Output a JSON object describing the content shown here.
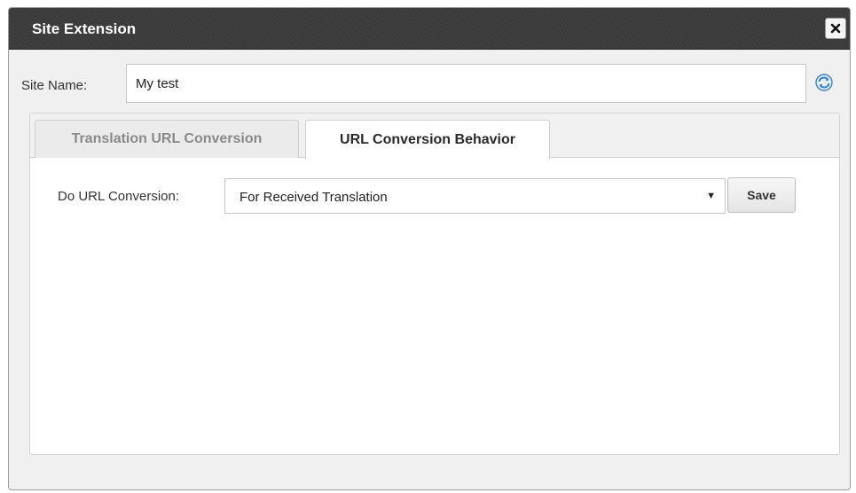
{
  "dialog": {
    "title": "Site Extension",
    "close_icon": "close-icon"
  },
  "site_name": {
    "label": "Site Name:",
    "value": "My test",
    "refresh_icon": "refresh-icon"
  },
  "tabs": [
    {
      "label": "Translation URL Conversion",
      "active": false
    },
    {
      "label": "URL Conversion Behavior",
      "active": true
    }
  ],
  "conversion": {
    "label": "Do URL Conversion:",
    "selected": "For Received Translation",
    "save_label": "Save"
  },
  "colors": {
    "titlebar": "#3a3a3a",
    "refresh_icon": "#3b7fc4"
  }
}
